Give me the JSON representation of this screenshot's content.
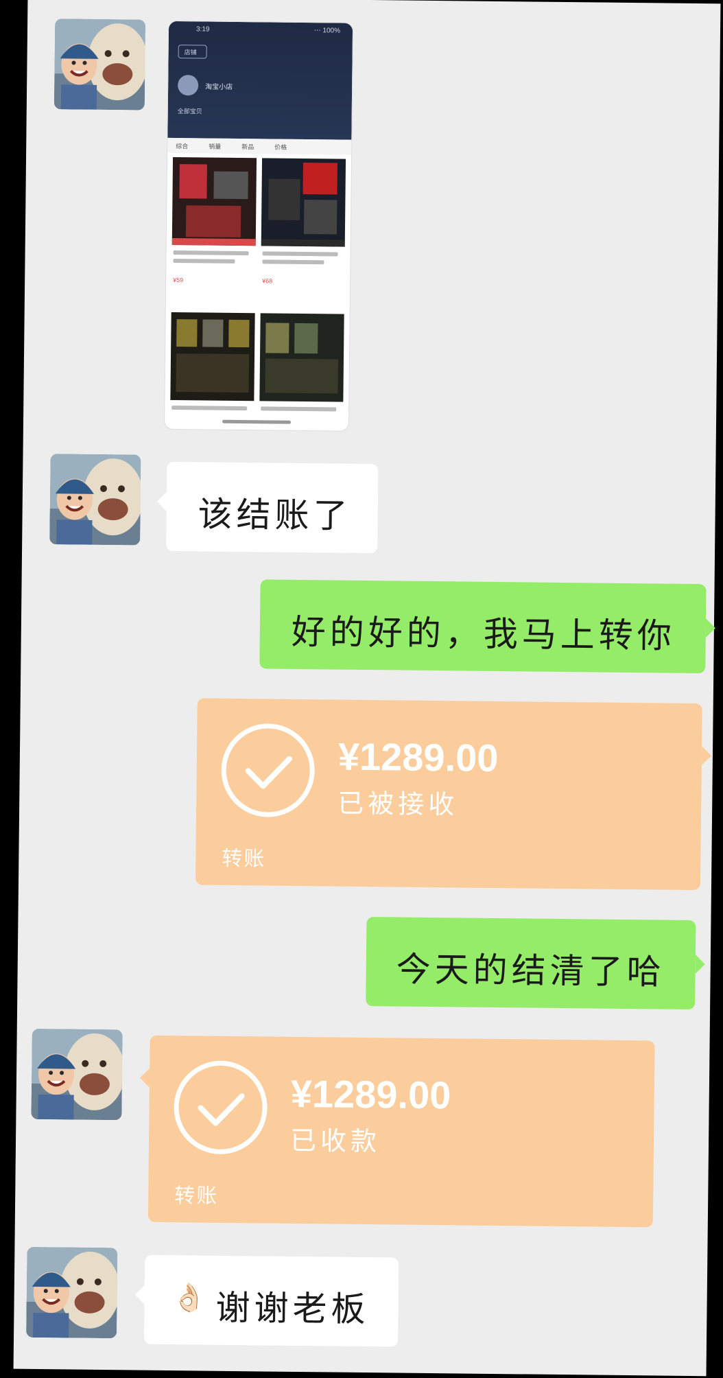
{
  "colors": {
    "background": "#ededed",
    "incoming_bubble": "#ffffff",
    "outgoing_bubble": "#95ec69",
    "transfer_card": "#fbcd9c"
  },
  "thumbnail": {
    "status_time": "3:19",
    "status_right": "⋯ 100%",
    "shop_button": "店铺",
    "shop_name": "淘宝小店",
    "tab_label": "全部宝贝",
    "item_tabs": [
      "综合",
      "销量",
      "新品",
      "价格"
    ],
    "prices": [
      "¥59",
      "¥68"
    ]
  },
  "messages": [
    {
      "id": "m1",
      "side": "left",
      "kind": "image",
      "icon": "shop-screenshot"
    },
    {
      "id": "m2",
      "side": "left",
      "kind": "text",
      "text": "该结账了"
    },
    {
      "id": "m3",
      "side": "right",
      "kind": "text",
      "text": "好的好的，我马上转你"
    },
    {
      "id": "m4",
      "side": "right",
      "kind": "transfer",
      "amount": "¥1289.00",
      "status": "已被接收",
      "label": "转账",
      "icon": "check-circle-icon"
    },
    {
      "id": "m5",
      "side": "right",
      "kind": "text",
      "text": "今天的结清了哈"
    },
    {
      "id": "m6",
      "side": "left",
      "kind": "transfer",
      "amount": "¥1289.00",
      "status": "已收款",
      "label": "转账",
      "icon": "check-circle-icon"
    },
    {
      "id": "m7",
      "side": "left",
      "kind": "text",
      "emoji": "👌🏻",
      "text": "谢谢老板"
    }
  ]
}
